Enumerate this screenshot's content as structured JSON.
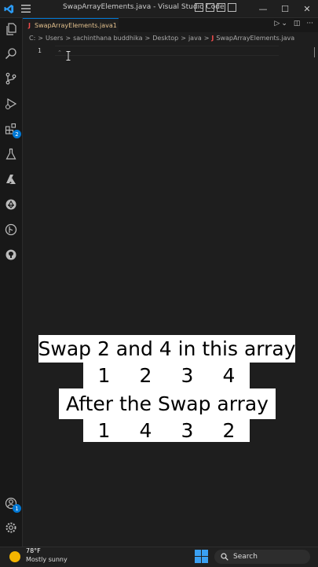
{
  "window": {
    "title": "SwapArrayElements.java - Visual Studio Code",
    "controls": {
      "minimize": "—",
      "maximize": "☐",
      "close": "✕"
    }
  },
  "activity_bar": {
    "extensions_badge": "2",
    "accounts_badge": "1"
  },
  "tab": {
    "icon_letter": "J",
    "label": "SwapArrayElements.java",
    "modified_marker": "1"
  },
  "breadcrumb": {
    "parts": [
      "C:",
      "Users",
      "sachinthana buddhika",
      "Desktop",
      "java"
    ],
    "file_icon": "J",
    "file": "SwapArrayElements.java",
    "separator": ">"
  },
  "editor": {
    "line_number": "1"
  },
  "captions": {
    "line1": "Swap 2 and 4 in this array",
    "before": [
      "1",
      "2",
      "3",
      "4"
    ],
    "line3": "After the Swap array",
    "after": [
      "1",
      "4",
      "3",
      "2"
    ]
  },
  "taskbar": {
    "temperature": "78°F",
    "weather": "Mostly sunny",
    "search_label": "Search"
  }
}
